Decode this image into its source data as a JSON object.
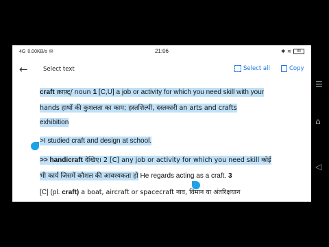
{
  "status": {
    "signal": "4G",
    "speed": "0.00KB/s",
    "time": "21:06",
    "battery": "80"
  },
  "appbar": {
    "title": "Select text",
    "select_all": "Select all",
    "copy": "Copy"
  },
  "text": {
    "l1_word": "craft",
    "l1_rest": " क्राफ़्ट्/ noun ",
    "l1_num": "1",
    "l1_def": " [C,U] a job or activity for which you need skill with your",
    "l2": "hands हाथों की कुशलता का काम; हस्तशिल्पी, दस्तकारी an arts and crafts",
    "l3": "exhibition",
    "l4": ">I studied craft and    design at school.",
    "l5_head": ">> handicraft",
    "l5_rest": " देखिए। 2  [C] any job or activity for which you need skill कोई",
    "l6_sel": "भी कार्य जिसमें कौशल की आवश्यकता हो",
    "l6_rest": " He regards acting as a craft. ",
    "l6_num": "3",
    "l7_a": "[C] (pl. ",
    "l7_b": "craft)",
    "l7_c": " a boat, aircraft or spacecraft नाव, विमान या अंतरिक्षयान"
  }
}
